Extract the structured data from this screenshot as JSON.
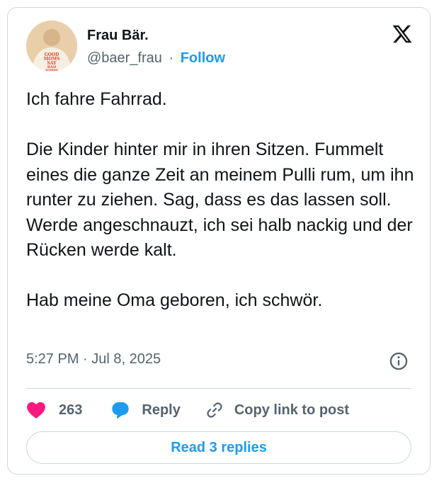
{
  "author": {
    "name": "Frau Bär.",
    "handle": "@baer_frau",
    "separator": "·",
    "follow_label": "Follow",
    "avatar_shirt_text": [
      "GOOD",
      "MOMS",
      "SAY",
      "BAD",
      "WORDS"
    ]
  },
  "post": {
    "paragraphs": [
      "Ich fahre Fahrrad.",
      "Die Kinder hinter mir in ihren Sitzen. Fummelt eines die ganze Zeit an meinem Pulli rum, um ihn runter zu ziehen. Sag, dass es das lassen soll. Werde angeschnauzt, ich sei halb nackig und der Rücken werde kalt.",
      "Hab meine Oma geboren, ich schwör."
    ],
    "timestamp": "5:27 PM · Jul 8, 2025"
  },
  "actions": {
    "like_count": "263",
    "reply_label": "Reply",
    "copy_label": "Copy link to post"
  },
  "footer": {
    "read_replies_label": "Read 3 replies"
  },
  "colors": {
    "accent": "#1d9bf0",
    "like": "#f91880",
    "secondary_text": "#536471",
    "border": "#cfd9de"
  },
  "icons": [
    "x-logo-icon",
    "info-icon",
    "heart-icon",
    "reply-bubble-icon",
    "link-icon"
  ]
}
